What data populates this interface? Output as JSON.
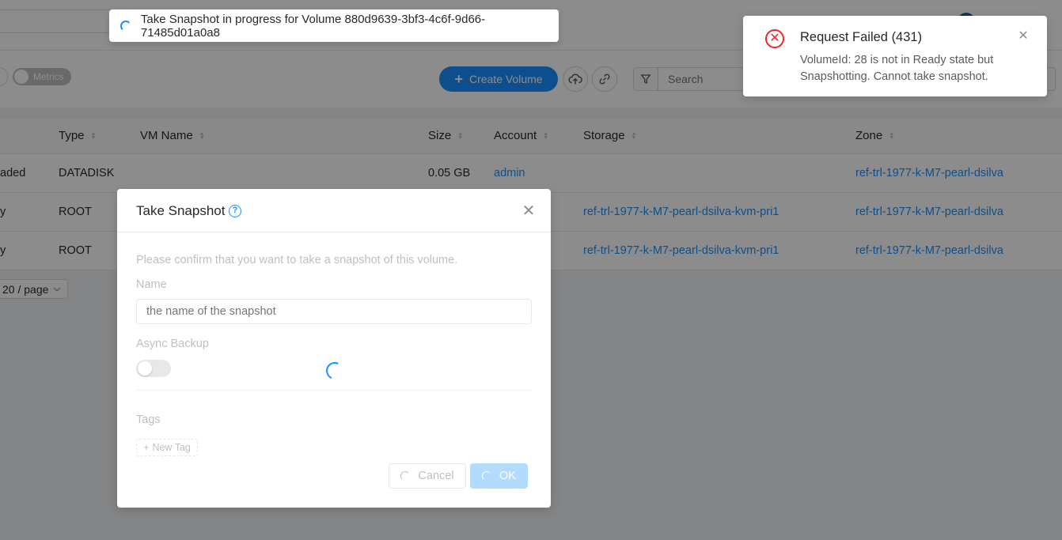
{
  "toolbar": {
    "metrics_label": "Metrics",
    "create_volume_label": "Create Volume",
    "search_placeholder": "Search"
  },
  "table": {
    "columns": [
      "Type",
      "VM Name",
      "Size",
      "Account",
      "Storage",
      "Zone"
    ],
    "rows": [
      {
        "state": "aded",
        "type": "DATADISK",
        "vm_name": "",
        "size": "0.05 GB",
        "account": "admin",
        "storage": "",
        "zone": "ref-trl-1977-k-M7-pearl-dsilva"
      },
      {
        "state": "y",
        "type": "ROOT",
        "vm_name": "",
        "size": "",
        "account": "",
        "storage": "ref-trl-1977-k-M7-pearl-dsilva-kvm-pri1",
        "zone": "ref-trl-1977-k-M7-pearl-dsilva"
      },
      {
        "state": "y",
        "type": "ROOT",
        "vm_name": "",
        "size": "",
        "account": "",
        "storage": "ref-trl-1977-k-M7-pearl-dsilva-kvm-pri1",
        "zone": "ref-trl-1977-k-M7-pearl-dsilva"
      }
    ]
  },
  "pagination": {
    "page_size_label": "20 / page"
  },
  "loading_message": {
    "text": "Take Snapshot in progress for Volume 880d9639-3bf3-4c6f-9d66-71485d01a0a8"
  },
  "notification": {
    "title": "Request Failed (431)",
    "description": "VolumeId: 28 is not in Ready state but Snapshotting. Cannot take snapshot."
  },
  "modal": {
    "title": "Take Snapshot",
    "confirm_text": "Please confirm that you want to take a snapshot of this volume.",
    "name_label": "Name",
    "name_placeholder": "the name of the snapshot",
    "async_backup_label": "Async Backup",
    "tags_label": "Tags",
    "new_tag_label": "New Tag",
    "cancel_label": "Cancel",
    "ok_label": "OK"
  },
  "colors": {
    "primary": "#1890ff",
    "error": "#f5222d",
    "ok_disabled": "#b3dbff"
  }
}
